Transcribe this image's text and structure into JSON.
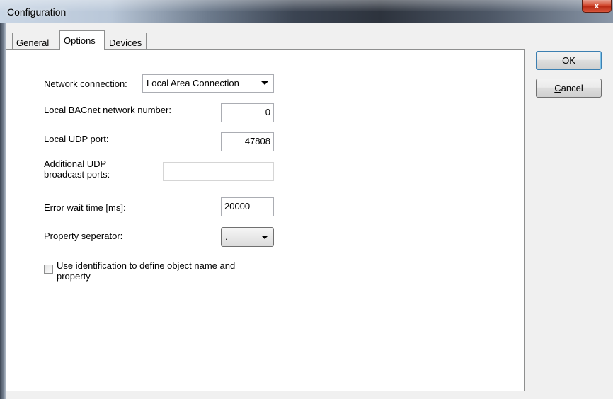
{
  "window": {
    "title": "Configuration",
    "close_glyph": "x"
  },
  "tabs": [
    {
      "label": "General",
      "active": false
    },
    {
      "label": "Options",
      "active": true
    },
    {
      "label": "Devices",
      "active": false
    }
  ],
  "options": {
    "network_connection": {
      "label": "Network connection:",
      "value": "Local Area Connection"
    },
    "network_number": {
      "label": "Local BACnet network number:",
      "value": "0"
    },
    "udp_port": {
      "label": "Local UDP port:",
      "value": "47808"
    },
    "additional_ports": {
      "label_line1": "Additional UDP",
      "label_line2": "broadcast ports:",
      "value": ""
    },
    "error_wait": {
      "label": "Error wait time [ms]:",
      "value": "20000"
    },
    "property_separator": {
      "label": "Property seperator:",
      "value": "."
    },
    "use_identification": {
      "label_line1": "Use identification to define object name and",
      "label_line2": "property",
      "checked": false
    }
  },
  "buttons": {
    "ok": "OK",
    "cancel_prefix": "C",
    "cancel_rest": "ancel"
  }
}
